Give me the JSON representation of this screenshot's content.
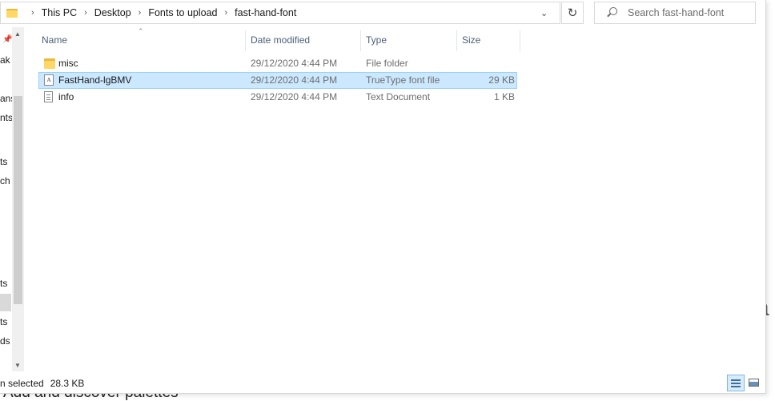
{
  "background": {
    "large_text_1": "n",
    "large_text_2": "a",
    "bottom_text": "Add and discover palettes"
  },
  "address": {
    "breadcrumbs": [
      "This PC",
      "Desktop",
      "Fonts to upload",
      "fast-hand-font"
    ]
  },
  "search": {
    "placeholder": "Search fast-hand-font"
  },
  "nav": {
    "items": [
      "ak",
      "ans",
      "nts",
      "ts",
      "ch",
      "ts",
      "ts",
      "ds"
    ]
  },
  "columns": {
    "name": "Name",
    "date": "Date modified",
    "type": "Type",
    "size": "Size"
  },
  "files": [
    {
      "name": "misc",
      "date": "29/12/2020 4:44 PM",
      "type": "File folder",
      "size": "",
      "icon": "folder-icon"
    },
    {
      "name": "FastHand-lgBMV",
      "date": "29/12/2020 4:44 PM",
      "type": "TrueType font file",
      "size": "29 KB",
      "icon": "font-file-icon"
    },
    {
      "name": "info",
      "date": "29/12/2020 4:44 PM",
      "type": "Text Document",
      "size": "1 KB",
      "icon": "text-file-icon"
    }
  ],
  "status": {
    "selection": "n selected",
    "size": "28.3 KB"
  },
  "colors": {
    "selection_bg": "#cce8ff",
    "selection_border": "#99d1ff",
    "folder": "#ffd766"
  }
}
